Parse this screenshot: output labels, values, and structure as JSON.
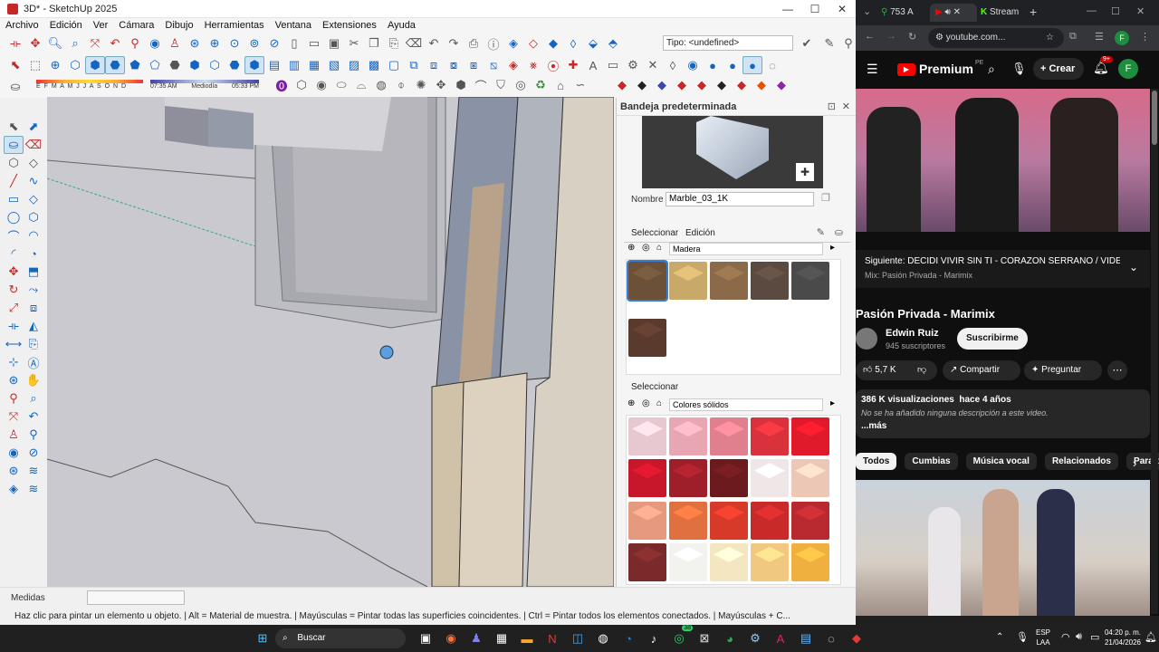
{
  "sketchup": {
    "title": "3D* - SketchUp 2025",
    "menu": [
      "Archivo",
      "Edición",
      "Ver",
      "Cámara",
      "Dibujo",
      "Herramientas",
      "Ventana",
      "Extensiones",
      "Ayuda"
    ],
    "tag_label": "Tipo: <undefined>",
    "shadow": {
      "months": "E F M A M J J A S O N D",
      "time_start": "07:35 AM",
      "time_mid": "Mediodía",
      "time_end": "05:33 PM"
    },
    "measures_label": "Medidas",
    "status_hint": "Haz clic para pintar un elemento u objeto. | Alt = Material de muestra. | Mayúsculas = Pintar todas las superficies coincidentes. | Ctrl = Pintar todos los elementos conectados. | Mayúsculas + C..."
  },
  "tray": {
    "title": "Bandeja predeterminada",
    "name_label": "Nombre",
    "name_value": "Marble_03_1K",
    "tab_select": "Seleccionar",
    "tab_edit": "Edición",
    "library1": "Madera",
    "library2_label": "Seleccionar",
    "library2": "Colores sólidos",
    "wood_swatches": [
      "#6b5138",
      "#c9a96a",
      "#8a6a48",
      "#5b4a40",
      "#4a4a4a",
      "#5a3a2c"
    ],
    "color_swatches": [
      "#e8c8d0",
      "#e8a6b2",
      "#e07f8e",
      "#d9323c",
      "#e01a2a",
      "#c8162a",
      "#9e1f2a",
      "#6b1a1e",
      "#efe6e8",
      "#edc7b6",
      "#e59a80",
      "#e0703f",
      "#d83a2a",
      "#c82a2a",
      "#b82a30",
      "#7a2a2a",
      "#f2f2ef",
      "#f3e6c0",
      "#f0c880",
      "#f0b040"
    ]
  },
  "browser": {
    "tabs": [
      "753 A",
      "",
      "Stream"
    ],
    "url": "youtube.com...",
    "premium_label": "Premium",
    "region": "PE",
    "create_label": "Crear",
    "notif_count": "9+",
    "avatar_letter": "F",
    "next_label": "Siguiente: DECIDI VIVIR SIN TI - CORAZON SERRANO / VIDEO CLI...",
    "mix_label": "Mix: Pasión Privada - Marimix",
    "video_title": "Pasión Privada - Marimix",
    "channel": "Edwin Ruiz",
    "subs": "945 suscriptores",
    "subscribe": "Suscribirme",
    "likes": "5,7 K",
    "share": "Compartir",
    "ask": "Preguntar",
    "views": "386 K visualizaciones  hace 4 años",
    "desc": "No se ha añadido ninguna descripción a este video.",
    "more": "...más",
    "chips": [
      "Todos",
      "Cumbias",
      "Música vocal",
      "Relacionados",
      "Para ti"
    ]
  },
  "taskbar": {
    "search": "Buscar",
    "lang1": "ESP",
    "lang2": "LAA",
    "time": "04:20 p. m.",
    "date": "21/04/2026",
    "whatsapp_badge": "38"
  }
}
